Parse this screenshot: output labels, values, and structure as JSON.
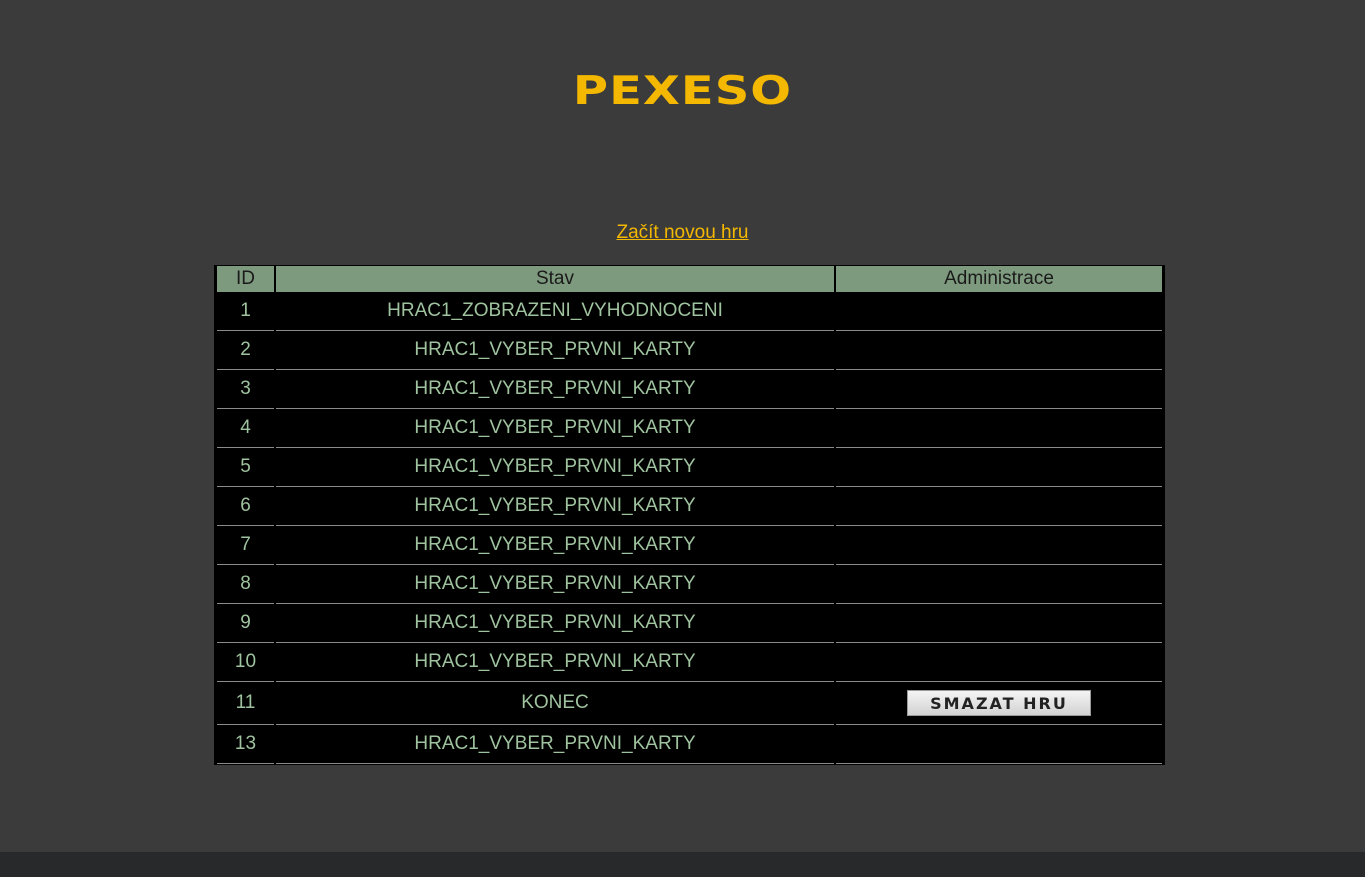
{
  "logo": "PEXESO",
  "new_game_link": "Začít novou hru",
  "table": {
    "headers": [
      "ID",
      "Stav",
      "Administrace"
    ],
    "rows": [
      {
        "id": "1",
        "stav": "HRAC1_ZOBRAZENI_VYHODNOCENI",
        "admin": ""
      },
      {
        "id": "2",
        "stav": "HRAC1_VYBER_PRVNI_KARTY",
        "admin": ""
      },
      {
        "id": "3",
        "stav": "HRAC1_VYBER_PRVNI_KARTY",
        "admin": ""
      },
      {
        "id": "4",
        "stav": "HRAC1_VYBER_PRVNI_KARTY",
        "admin": ""
      },
      {
        "id": "5",
        "stav": "HRAC1_VYBER_PRVNI_KARTY",
        "admin": ""
      },
      {
        "id": "6",
        "stav": "HRAC1_VYBER_PRVNI_KARTY",
        "admin": ""
      },
      {
        "id": "7",
        "stav": "HRAC1_VYBER_PRVNI_KARTY",
        "admin": ""
      },
      {
        "id": "8",
        "stav": "HRAC1_VYBER_PRVNI_KARTY",
        "admin": ""
      },
      {
        "id": "9",
        "stav": "HRAC1_VYBER_PRVNI_KARTY",
        "admin": ""
      },
      {
        "id": "10",
        "stav": "HRAC1_VYBER_PRVNI_KARTY",
        "admin": ""
      },
      {
        "id": "11",
        "stav": "KONEC",
        "admin": "SMAZAT HRU"
      },
      {
        "id": "13",
        "stav": "HRAC1_VYBER_PRVNI_KARTY",
        "admin": ""
      }
    ]
  },
  "colors": {
    "background": "#3b3b3b",
    "accent": "#f5b800",
    "header_bg": "#7e9a7e",
    "cell_text": "#9fc39f",
    "footer": "#28292b"
  }
}
